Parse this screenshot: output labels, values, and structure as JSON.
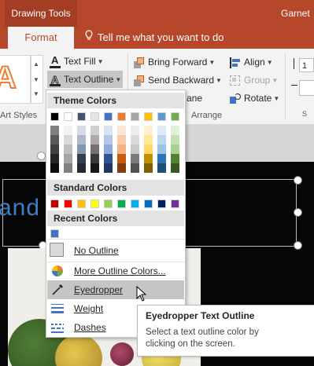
{
  "window": {
    "context_tab": "Drawing Tools",
    "user_name": "Garnet",
    "ribbon_tab": "Format",
    "tell_me": "Tell me what you want to do"
  },
  "ribbon": {
    "text_fill": "Text Fill",
    "text_outline": "Text Outline",
    "art_styles_group": "Art Styles",
    "bring_forward": "Bring Forward",
    "send_backward": "Send Backward",
    "selection_pane_partial": "ane",
    "align": "Align",
    "group": "Group",
    "rotate": "Rotate",
    "arrange_group": "Arrange",
    "size_partial": "1"
  },
  "slide": {
    "visible_text": "and V"
  },
  "dropdown": {
    "theme_header": "Theme Colors",
    "standard_header": "Standard Colors",
    "recent_header": "Recent Colors",
    "theme_top_row": [
      "#000000",
      "#ffffff",
      "#44546a",
      "#e7e6e6",
      "#4472c4",
      "#ed7d31",
      "#a5a5a5",
      "#ffc000",
      "#5b9bd5",
      "#70ad47"
    ],
    "theme_shades": [
      [
        "#7f7f7f",
        "#f2f2f2",
        "#d6dce4",
        "#d0cece",
        "#dae3f3",
        "#fbe5d6",
        "#ededed",
        "#fff2cc",
        "#deebf7",
        "#e2f0d9"
      ],
      [
        "#595959",
        "#d9d9d9",
        "#adb9ca",
        "#aeaaaa",
        "#b4c7e7",
        "#f8cbad",
        "#dbdbdb",
        "#ffe699",
        "#bdd7ee",
        "#c5e0b4"
      ],
      [
        "#404040",
        "#bfbfbf",
        "#8497b0",
        "#757171",
        "#8faadc",
        "#f4b183",
        "#c9c9c9",
        "#ffd966",
        "#9dc3e6",
        "#a9d18e"
      ],
      [
        "#262626",
        "#a6a6a6",
        "#333f50",
        "#3a3838",
        "#2f5597",
        "#c55a11",
        "#7b7b7b",
        "#bf9000",
        "#2e75b6",
        "#548235"
      ],
      [
        "#0d0d0d",
        "#808080",
        "#222a35",
        "#171616",
        "#203864",
        "#843c0c",
        "#525252",
        "#7f6000",
        "#1f4e79",
        "#385723"
      ]
    ],
    "standard_colors": [
      "#c00000",
      "#ff0000",
      "#ffc000",
      "#ffff00",
      "#92d050",
      "#00b050",
      "#00b0f0",
      "#0070c0",
      "#002060",
      "#7030a0"
    ],
    "recent_colors": [
      "#4472c4"
    ],
    "no_outline": "No Outline",
    "more_colors": "More Outline Colors...",
    "eyedropper": "Eyedropper",
    "weight": "Weight",
    "dashes": "Dashes"
  },
  "tooltip": {
    "title": "Eyedropper Text Outline",
    "body_line1": "Select a text outline color by",
    "body_line2": "clicking on the screen."
  },
  "colors": {
    "accent": "#b7472a",
    "slide_text": "#3f7ec1",
    "hover_item": "#c5c5c5"
  }
}
